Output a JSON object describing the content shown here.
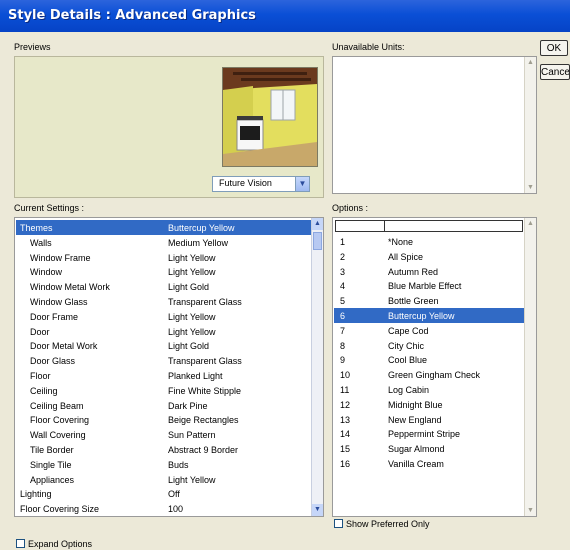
{
  "window": {
    "title": "Style Details : Advanced Graphics"
  },
  "buttons": {
    "ok": "OK",
    "cancel": "Cance"
  },
  "previews": {
    "label": "Previews",
    "select_value": "Future Vision"
  },
  "unavailable": {
    "label": "Unavailable Units:"
  },
  "current_settings": {
    "label": "Current Settings :",
    "rows": [
      {
        "name": "Themes",
        "value": "Buttercup Yellow",
        "indent": 0,
        "selected": true
      },
      {
        "name": "Walls",
        "value": "Medium Yellow",
        "indent": 1
      },
      {
        "name": "Window Frame",
        "value": "Light Yellow",
        "indent": 1
      },
      {
        "name": "Window",
        "value": "Light Yellow",
        "indent": 1
      },
      {
        "name": "Window Metal Work",
        "value": "Light Gold",
        "indent": 1
      },
      {
        "name": "Window Glass",
        "value": "Transparent Glass",
        "indent": 1
      },
      {
        "name": "Door Frame",
        "value": "Light Yellow",
        "indent": 1
      },
      {
        "name": "Door",
        "value": "Light Yellow",
        "indent": 1
      },
      {
        "name": "Door Metal Work",
        "value": "Light Gold",
        "indent": 1
      },
      {
        "name": "Door Glass",
        "value": "Transparent Glass",
        "indent": 1
      },
      {
        "name": "Floor",
        "value": "Planked Light",
        "indent": 1
      },
      {
        "name": "Ceiling",
        "value": "Fine White Stipple",
        "indent": 1
      },
      {
        "name": "Ceiling Beam",
        "value": "Dark Pine",
        "indent": 1
      },
      {
        "name": "Floor Covering",
        "value": "Beige Rectangles",
        "indent": 1
      },
      {
        "name": "Wall Covering",
        "value": "Sun Pattern",
        "indent": 1
      },
      {
        "name": "Tile Border",
        "value": "Abstract 9 Border",
        "indent": 1
      },
      {
        "name": "Single Tile",
        "value": "Buds",
        "indent": 1
      },
      {
        "name": "Appliances",
        "value": "Light Yellow",
        "indent": 1
      },
      {
        "name": "Lighting",
        "value": "Off",
        "indent": 0
      },
      {
        "name": "Floor Covering Size",
        "value": "100",
        "indent": 0
      }
    ]
  },
  "options": {
    "label": "Options :",
    "rows": [
      {
        "num": "1",
        "name": "*None"
      },
      {
        "num": "2",
        "name": "All Spice"
      },
      {
        "num": "3",
        "name": "Autumn Red"
      },
      {
        "num": "4",
        "name": "Blue Marble Effect"
      },
      {
        "num": "5",
        "name": "Bottle Green"
      },
      {
        "num": "6",
        "name": "Buttercup Yellow",
        "selected": true
      },
      {
        "num": "7",
        "name": "Cape Cod"
      },
      {
        "num": "8",
        "name": "City Chic"
      },
      {
        "num": "9",
        "name": "Cool Blue"
      },
      {
        "num": "10",
        "name": "Green Gingham Check"
      },
      {
        "num": "11",
        "name": "Log Cabin"
      },
      {
        "num": "12",
        "name": "Midnight Blue"
      },
      {
        "num": "13",
        "name": "New England"
      },
      {
        "num": "14",
        "name": "Peppermint Stripe"
      },
      {
        "num": "15",
        "name": "Sugar Almond"
      },
      {
        "num": "16",
        "name": "Vanilla Cream"
      }
    ]
  },
  "show_preferred_only": {
    "label": "Show Preferred Only",
    "checked": false
  },
  "expand_options": {
    "label": "Expand Options",
    "checked": false
  },
  "colors": {
    "titlebar": "#0a4fd6",
    "selection": "#316ac5",
    "dialog_bg": "#ece9d8"
  }
}
